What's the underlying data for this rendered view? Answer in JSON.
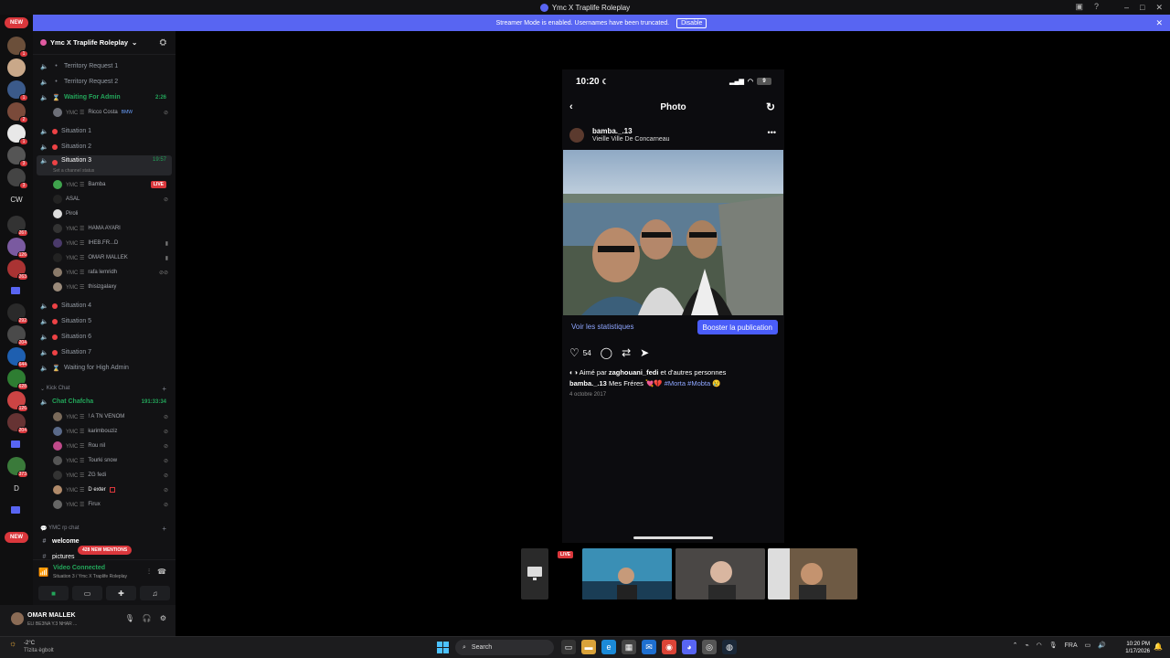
{
  "window": {
    "title": "Ymc X Traplife Roleplay"
  },
  "banner": {
    "message": "Streamer Mode is enabled. Usernames have been truncated.",
    "button": "Disable"
  },
  "rail": {
    "new_top": "NEW",
    "new_bottom": "NEW",
    "cw_label": "CW",
    "d_label": "D",
    "badges": [
      "1",
      "1",
      "2",
      "1",
      "3",
      "3",
      "267",
      "126",
      "263",
      "292",
      "204",
      "644",
      "628",
      "126",
      "204",
      "373"
    ]
  },
  "server": {
    "name": "Ymc X Traplife Roleplay"
  },
  "channels": [
    {
      "name": "Territory Request 1"
    },
    {
      "name": "Territory Request 2"
    },
    {
      "name": "Waiting For Admin",
      "time": "2:26"
    },
    {
      "name": "Situation 1"
    },
    {
      "name": "Situation 2"
    },
    {
      "name": "Situation 3",
      "time": "19:57",
      "status": "Set a channel status"
    },
    {
      "name": "Situation 4"
    },
    {
      "name": "Situation 5"
    },
    {
      "name": "Situation 6"
    },
    {
      "name": "Situation 7"
    },
    {
      "name": "Waiting for High Admin"
    }
  ],
  "waiting_users": [
    {
      "prefix": "YMC ☰",
      "name": "Ricco Costa",
      "tag": "BMW"
    }
  ],
  "situation3_users": [
    {
      "prefix": "YMC ☰",
      "name": "Bamba",
      "live": "LIVE"
    },
    {
      "prefix": "",
      "name": "ASAL"
    },
    {
      "prefix": "",
      "name": "Piroli"
    },
    {
      "prefix": "YMC ☰",
      "name": "HAMA AYARI"
    },
    {
      "prefix": "YMC ☰",
      "name": "IHEB.FR...D"
    },
    {
      "prefix": "YMC ☰",
      "name": "OMAR MALLEK"
    },
    {
      "prefix": "YMC ☰",
      "name": "rafa lemridh"
    },
    {
      "prefix": "YMC ☰",
      "name": "thisizgalaxy"
    }
  ],
  "kick_category": "Kick Chat",
  "chafcha": {
    "name": "Chat Chafcha",
    "time": "191:33:34",
    "users": [
      {
        "prefix": "YMC ☰",
        "name": "! A TN VENOM"
      },
      {
        "prefix": "YMC ☰",
        "name": "karimbouziz"
      },
      {
        "prefix": "YMC ☰",
        "name": "Rou nil"
      },
      {
        "prefix": "YMC ☰",
        "name": "Tourki snow"
      },
      {
        "prefix": "YMC ☰",
        "name": "ZG fedi"
      },
      {
        "prefix": "YMC ☰",
        "name": "D exter"
      },
      {
        "prefix": "YMC ☰",
        "name": "Firux"
      }
    ]
  },
  "rp_category": "YMC rp chat",
  "text_channels": [
    "welcome",
    "pictures"
  ],
  "mentions": "428 NEW MENTIONS",
  "voice": {
    "title": "Video Connected",
    "subtitle": "Situation 3 / Ymc X Traplife Roleplay"
  },
  "user_panel": {
    "name": "OMAR MALLEK",
    "status": "ELI BE3NA Y.3 NHAR ..."
  },
  "phone": {
    "time": "10:20",
    "battery": "9",
    "nav_title": "Photo",
    "username": "bamba._.13",
    "location": "Vieille Ville De Concarneau",
    "stats_link": "Voir les statistiques",
    "boost_button": "Booster la publication",
    "likes": "54",
    "liked_prefix": "Aimé par ",
    "liked_user": "zaghouani_fedi",
    "liked_suffix": " et d'autres personnes",
    "caption_user": "bamba._.13",
    "caption_text": " Mes Fréres 💘💔 ",
    "tag1": "#Morta",
    "tag2": "#Mobta",
    "caption_emoji": " 😢",
    "date": "4 octobre 2017"
  },
  "tiles": {
    "live": "LIVE"
  },
  "taskbar": {
    "weather_temp": "-2°C",
    "weather_desc": "Tîzita ègbolt",
    "search": "Search",
    "lang": "FRA",
    "time": "10:20 PM",
    "date": "1/17/2026"
  },
  "colors": {
    "accent": "#5865f2",
    "live": "#da373c",
    "online": "#23a55a"
  }
}
